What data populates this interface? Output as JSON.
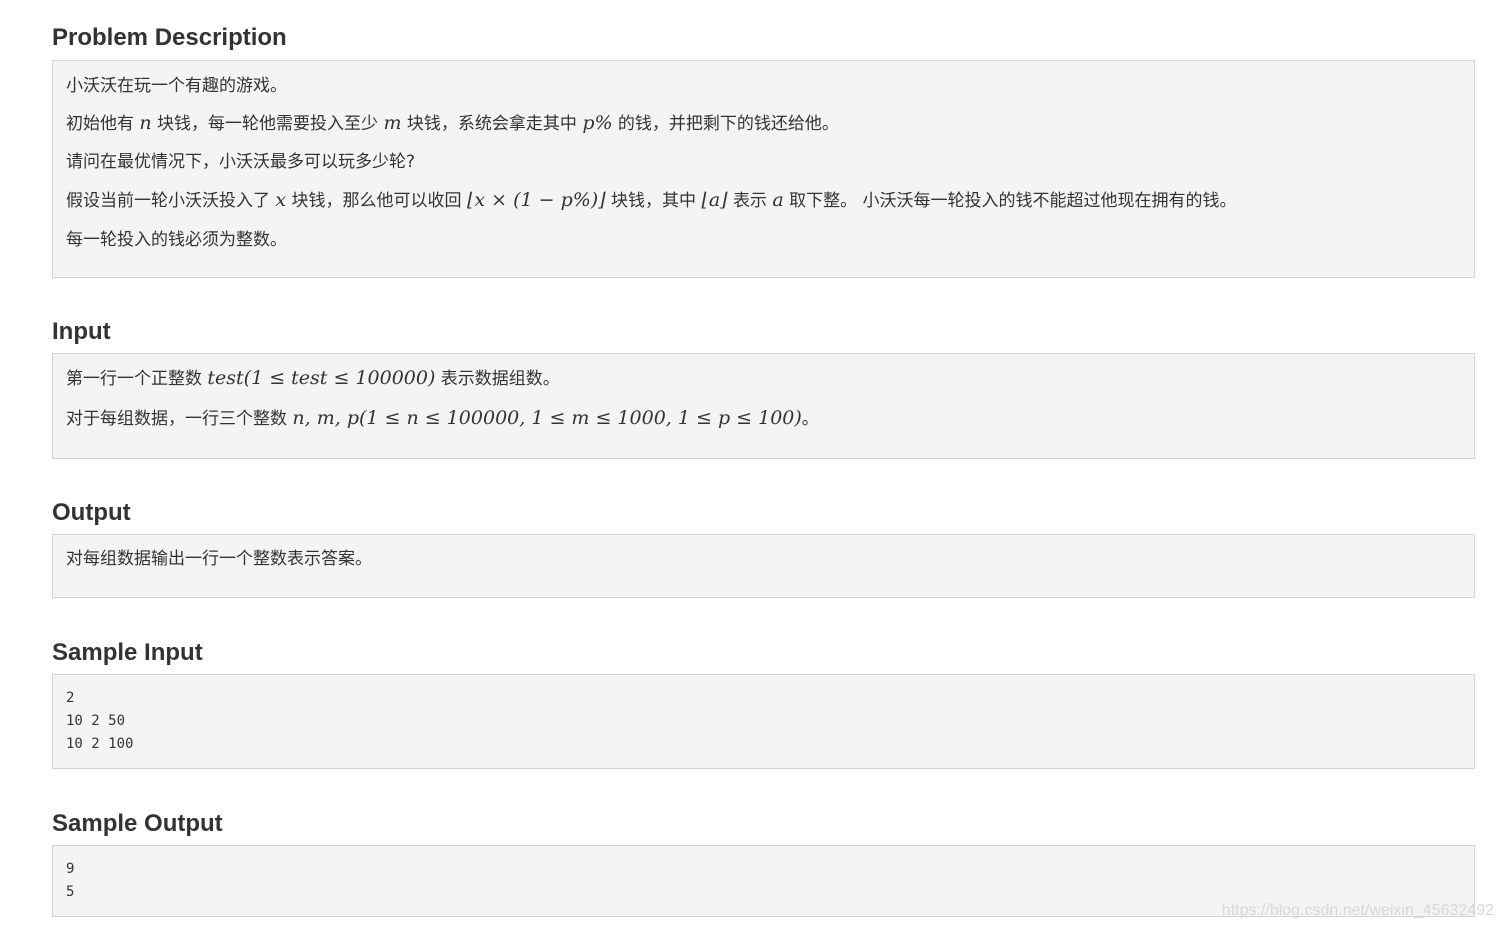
{
  "problem": {
    "title": "Problem Description",
    "lines": [
      "小沃沃在玩一个有趣的游戏。",
      "请问在最优情况下，小沃沃最多可以玩多少轮?",
      "每一轮投入的钱必须为整数。"
    ],
    "line2": {
      "a": "初始他有 ",
      "n": "n",
      "b": " 块钱，每一轮他需要投入至少 ",
      "m": "m",
      "c": " 块钱，系统会拿走其中 ",
      "p": "p%",
      "d": " 的钱，并把剩下的钱还给他。"
    },
    "line4": {
      "a": "假设当前一轮小沃沃投入了 ",
      "x": "x",
      "b": " 块钱，那么他可以收回 ",
      "formula": "⌊x × (1 − p%)⌋",
      "c": " 块钱，其中 ",
      "floor_a": "⌊a⌋",
      "d": " 表示 ",
      "a_var": "a",
      "e": " 取下整。 小沃沃每一轮投入的钱不能超过他现在拥有的钱。"
    }
  },
  "input": {
    "title": "Input",
    "line1": {
      "a": "第一行一个正整数 ",
      "formula": "test(1 ≤ test ≤ 100000)",
      "b": " 表示数据组数。"
    },
    "line2": {
      "a": "对于每组数据，一行三个整数 ",
      "formula": "n, m, p(1 ≤ n ≤ 100000, 1 ≤ m ≤ 1000, 1 ≤ p ≤ 100)",
      "b": "。"
    }
  },
  "output": {
    "title": "Output",
    "line1": "对每组数据输出一行一个整数表示答案。"
  },
  "sample_input": {
    "title": "Sample Input",
    "lines": [
      "2",
      "10 2 50",
      "10 2 100"
    ]
  },
  "sample_output": {
    "title": "Sample Output",
    "lines": [
      "9",
      "5"
    ]
  },
  "watermark": "https://blog.csdn.net/weixin_45632492"
}
